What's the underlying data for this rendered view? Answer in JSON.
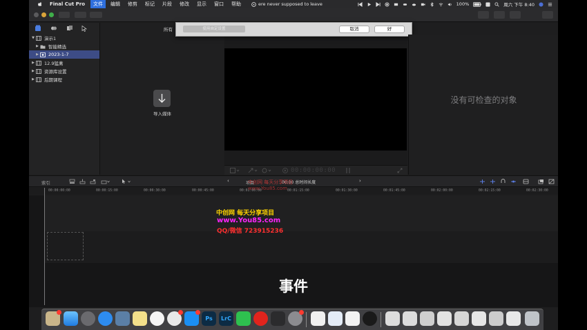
{
  "menubar": {
    "app_name": "Final Cut Pro",
    "menus": [
      "文件",
      "编辑",
      "修剪",
      "标记",
      "片段",
      "修改",
      "显示",
      "窗口",
      "帮助"
    ],
    "now_playing": "ere never supposed to leave",
    "battery": "100%",
    "clock": "周六 下午 8:40"
  },
  "sidebar": {
    "libraries": [
      {
        "label": "演示1",
        "expanded": true,
        "level": 0
      },
      {
        "label": "智能精选",
        "expanded": false,
        "level": 1
      },
      {
        "label": "2023-1-7",
        "expanded": false,
        "level": 1,
        "selected": true
      },
      {
        "label": "12.9猛禽",
        "expanded": false,
        "level": 0
      },
      {
        "label": "资源库设置",
        "expanded": false,
        "level": 0
      },
      {
        "label": "后期课程",
        "expanded": false,
        "level": 0
      }
    ]
  },
  "browser": {
    "filter_label": "所有",
    "import_label": "导入媒体"
  },
  "dialog": {
    "field_placeholder": "使用自定设置",
    "cancel_label": "取消",
    "ok_label": "好"
  },
  "viewer": {
    "timecode": "00:00:00:00"
  },
  "inspector": {
    "empty_message": "没有可检查的对象"
  },
  "timeline_toolbar": {
    "index_label": "索引",
    "center_text": "00:00 总时间长度",
    "center_prefix": "项目"
  },
  "ruler": {
    "ticks": [
      "00:00:00:00",
      "00:00:15:00",
      "00:00:30:00",
      "00:00:45:00",
      "00:01:00:00",
      "00:01:15:00",
      "00:01:30:00",
      "00:01:45:00",
      "00:02:00:00",
      "00:02:15:00",
      "00:02:30:00"
    ]
  },
  "overlay": {
    "watermark_line1": "中创网 每天分享项目",
    "watermark_line2": "www.You85.com",
    "watermark_line3": "QQ/微信 723915236",
    "subtitle": "事件"
  },
  "colors": {
    "selected_row": "#3d4c86",
    "menu_active": "#2f6fdc",
    "watermark_yellow": "#ffd400",
    "watermark_magenta": "#ff25ff",
    "watermark_red": "#ff3030"
  }
}
